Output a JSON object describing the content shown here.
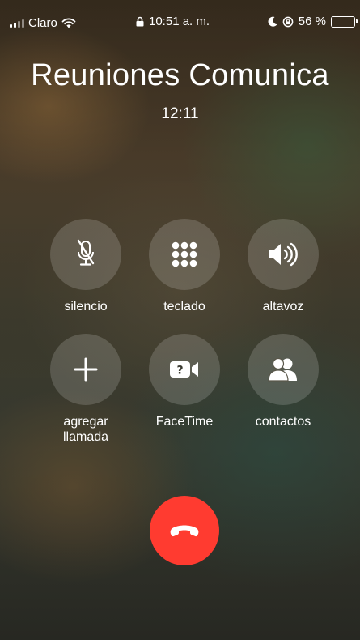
{
  "status_bar": {
    "carrier": "Claro",
    "time": "10:51 a. m.",
    "battery_percent": "56 %",
    "battery_level": 0.56,
    "battery_color": "#ffd60a"
  },
  "call": {
    "caller_name": "Reuniones Comunica",
    "duration": "12:11"
  },
  "controls": [
    {
      "id": "mute",
      "label": "silencio",
      "icon": "mic-muted-icon"
    },
    {
      "id": "keypad",
      "label": "teclado",
      "icon": "keypad-icon"
    },
    {
      "id": "speaker",
      "label": "altavoz",
      "icon": "speaker-icon"
    },
    {
      "id": "add",
      "label_line1": "agregar",
      "label_line2": "llamada",
      "icon": "plus-icon"
    },
    {
      "id": "facetime",
      "label": "FaceTime",
      "icon": "facetime-video-icon"
    },
    {
      "id": "contacts",
      "label": "contactos",
      "icon": "contacts-icon"
    }
  ],
  "end_call": {
    "icon": "phone-hangup-icon",
    "color": "#ff3b30"
  }
}
